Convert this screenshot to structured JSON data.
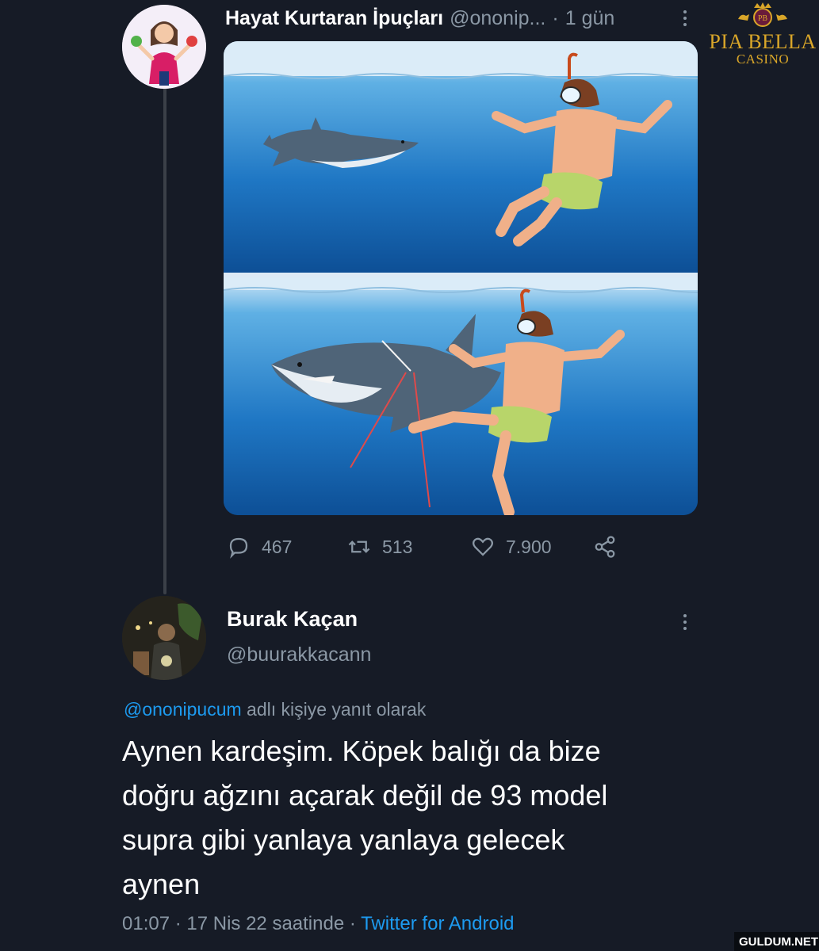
{
  "tweet1": {
    "author_name": "Hayat Kurtaran İpuçları",
    "author_handle": "@ononip...",
    "separator": "·",
    "time": "1 gün",
    "media_alt": "shark-escape-illustration",
    "stats": {
      "replies": "467",
      "retweets": "513",
      "likes": "7.900"
    }
  },
  "tweet2": {
    "author_name": "Burak Kaçan",
    "author_handle": "@buurakkacann",
    "reply_mention": "@ononipucum",
    "reply_suffix": " adlı kişiye yanıt olarak",
    "text_lines": [
      "Aynen kardeşim. Köpek balığı da bize",
      "doğru ağzını açarak değil de 93 model",
      "supra gibi yanlaya yanlaya gelecek",
      "aynen"
    ],
    "meta_time": "01:07 · 17 Nis 22 saatinde · ",
    "meta_source": "Twitter for Android"
  },
  "logo": {
    "name": "PIA BELLA",
    "sub": "CASINO",
    "monogram": "PB"
  },
  "watermark": "GULDUM.NET",
  "colors": {
    "background": "#161b26",
    "link": "#1d9bf0",
    "secondary_text": "#8b98a5",
    "logo_gold": "#d9a629"
  },
  "icons": [
    "reply-icon",
    "retweet-icon",
    "like-icon",
    "share-icon",
    "more-options-icon",
    "crown-icon"
  ]
}
